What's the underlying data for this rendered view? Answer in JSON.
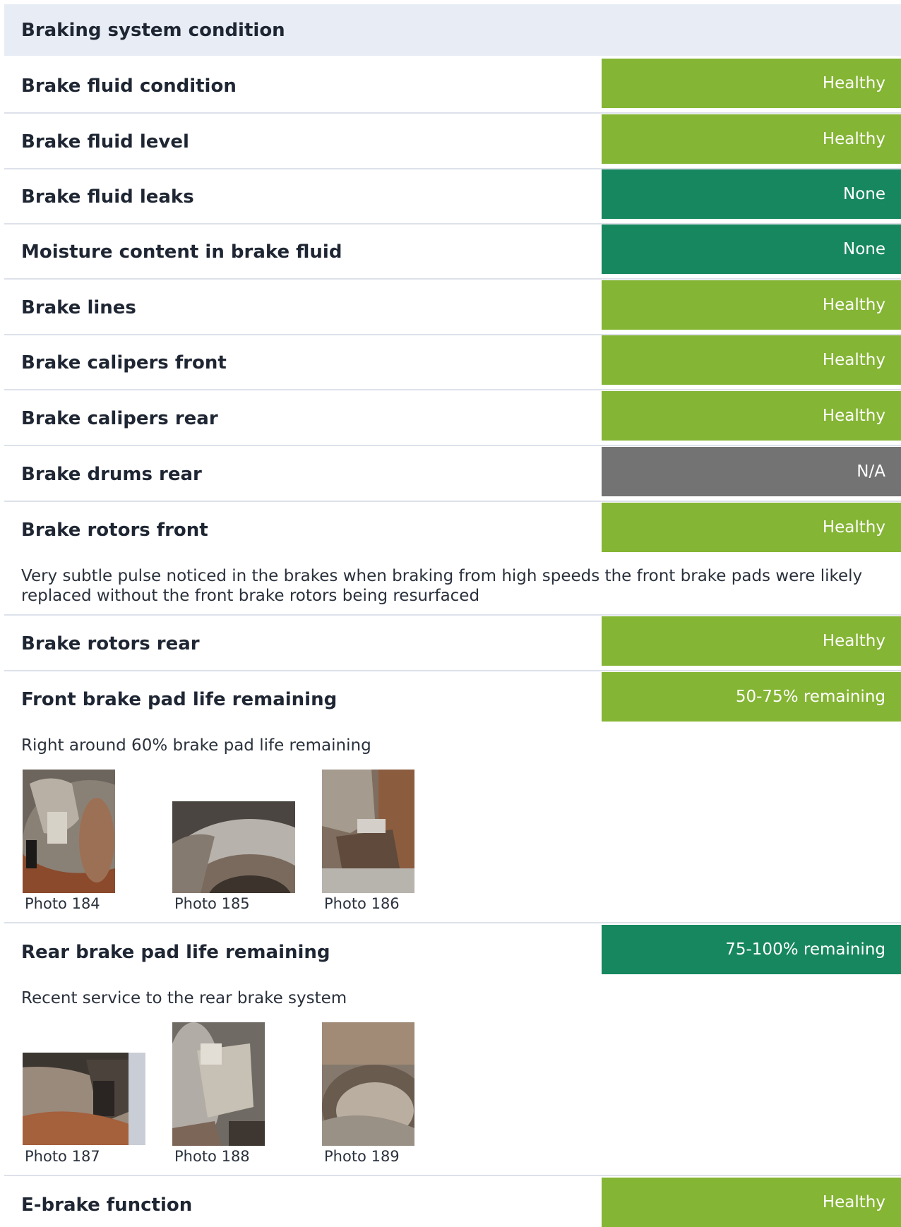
{
  "section": {
    "title": "Braking system condition"
  },
  "colors": {
    "healthy": "#84b534",
    "good": "#17875f",
    "na": "#737373",
    "header_bg": "#e8ecf4"
  },
  "items": [
    {
      "label": "Brake fluid condition",
      "status": "Healthy"
    },
    {
      "label": "Brake fluid level",
      "status": "Healthy"
    },
    {
      "label": "Brake fluid leaks",
      "status": "None"
    },
    {
      "label": "Moisture content in brake fluid",
      "status": "None"
    },
    {
      "label": "Brake lines",
      "status": "Healthy"
    },
    {
      "label": "Brake calipers front",
      "status": "Healthy"
    },
    {
      "label": "Brake calipers rear",
      "status": "Healthy"
    },
    {
      "label": "Brake drums rear",
      "status": "N/A"
    },
    {
      "label": "Brake rotors front",
      "status": "Healthy",
      "note": "Very subtle pulse noticed in the brakes when braking from high speeds the front brake pads were likely replaced without the front brake rotors being resurfaced"
    },
    {
      "label": "Brake rotors rear",
      "status": "Healthy"
    },
    {
      "label": "Front brake pad life remaining",
      "status": "50-75% remaining",
      "note": "Right around 60% brake pad life remaining",
      "photos": [
        {
          "caption": "Photo 184"
        },
        {
          "caption": "Photo 185"
        },
        {
          "caption": "Photo 186"
        }
      ]
    },
    {
      "label": "Rear brake pad life remaining",
      "status": "75-100% remaining",
      "note": "Recent service to the rear brake system",
      "photos": [
        {
          "caption": "Photo 187"
        },
        {
          "caption": "Photo 188"
        },
        {
          "caption": "Photo 189"
        }
      ]
    },
    {
      "label": "E-brake function",
      "status": "Healthy"
    }
  ]
}
